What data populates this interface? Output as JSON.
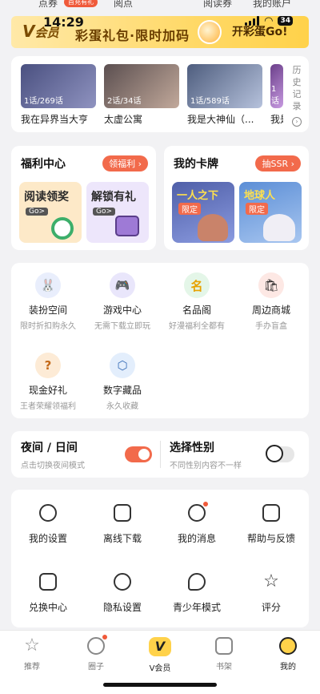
{
  "top_strip": {
    "items": [
      "点券",
      "阅点",
      "阅读券",
      "我的账户"
    ],
    "bubble": "首充有礼"
  },
  "status_bar": {
    "time": "14:29",
    "battery": "34"
  },
  "vip_banner": {
    "logo": "V",
    "logo_sub": "会员",
    "slogan": "彩蛋礼包·限时加码",
    "button": "开彩蛋Go!"
  },
  "history": {
    "more_label": "历史记录",
    "items": [
      {
        "badge": "1话/269话",
        "title": "我在异界当大亨",
        "color": "#6a6f9c"
      },
      {
        "badge": "2话/34话",
        "title": "太虚公寓",
        "color": "#8a7a78"
      },
      {
        "badge": "1话/589话",
        "title": "我是大神仙（...",
        "color": "#7d8aa6"
      },
      {
        "badge": "1话",
        "title": "我是",
        "color": "#9a6fb0"
      }
    ]
  },
  "welfare": {
    "title": "福利中心",
    "pill": "领福利",
    "tiles": [
      {
        "label": "阅读领奖",
        "go": "Go>",
        "color": "#fde9c8"
      },
      {
        "label": "解锁有礼",
        "go": "Go>",
        "color": "#ede6fb"
      }
    ]
  },
  "mycards": {
    "title": "我的卡牌",
    "pill": "抽SSR",
    "tiles": [
      {
        "label": "一人之下",
        "tag": "限定",
        "color": "#5d6fb8"
      },
      {
        "label": "地球人",
        "tag": "限定",
        "color": "#6f9ad8"
      }
    ]
  },
  "services": [
    {
      "name": "装扮空间",
      "sub": "限时折扣购永久",
      "icon": "bunny-avatar-icon",
      "bg": "#e9eefc",
      "glyph": "🐰"
    },
    {
      "name": "游戏中心",
      "sub": "无需下载立即玩",
      "icon": "gamepad-icon",
      "bg": "#e9e6fb",
      "glyph": "🎮"
    },
    {
      "name": "名品阁",
      "sub": "好漫福利全都有",
      "icon": "name-badge-icon",
      "bg": "#e4f6e8",
      "glyph": "名"
    },
    {
      "name": "周边商城",
      "sub": "手办盲盒",
      "icon": "shop-bag-icon",
      "bg": "#fde8e4",
      "glyph": "🛍"
    },
    {
      "name": "现金好礼",
      "sub": "王者荣耀领福利",
      "icon": "gift-box-icon",
      "bg": "#fdebd6",
      "glyph": "?"
    },
    {
      "name": "数字藏品",
      "sub": "永久收藏",
      "icon": "cube-icon",
      "bg": "#e3eefc",
      "glyph": "⬡"
    }
  ],
  "toggles": {
    "night": {
      "title": "夜间 / 日间",
      "sub": "点击切换夜间模式"
    },
    "gender": {
      "title": "选择性别",
      "sub": "不同性别内容不一样"
    }
  },
  "settings": [
    {
      "name": "我的设置",
      "icon": "settings-icon"
    },
    {
      "name": "离线下载",
      "icon": "download-icon"
    },
    {
      "name": "我的消息",
      "icon": "message-icon"
    },
    {
      "name": "帮助与反馈",
      "icon": "feedback-icon"
    },
    {
      "name": "兑换中心",
      "icon": "ticket-icon"
    },
    {
      "name": "隐私设置",
      "icon": "privacy-eye-icon"
    },
    {
      "name": "青少年模式",
      "icon": "teen-mode-icon"
    },
    {
      "name": "评分",
      "icon": "star-rating-icon"
    }
  ],
  "tabbar": [
    {
      "label": "推荐",
      "icon": "recommend-star-icon"
    },
    {
      "label": "圈子",
      "icon": "circle-icon"
    },
    {
      "label": "V会员",
      "icon": "vip-v-icon"
    },
    {
      "label": "书架",
      "icon": "bookshelf-icon"
    },
    {
      "label": "我的",
      "icon": "profile-face-icon"
    }
  ],
  "colors": {
    "accent": "#f26a4b",
    "vip_gold": "#ffd24a"
  }
}
